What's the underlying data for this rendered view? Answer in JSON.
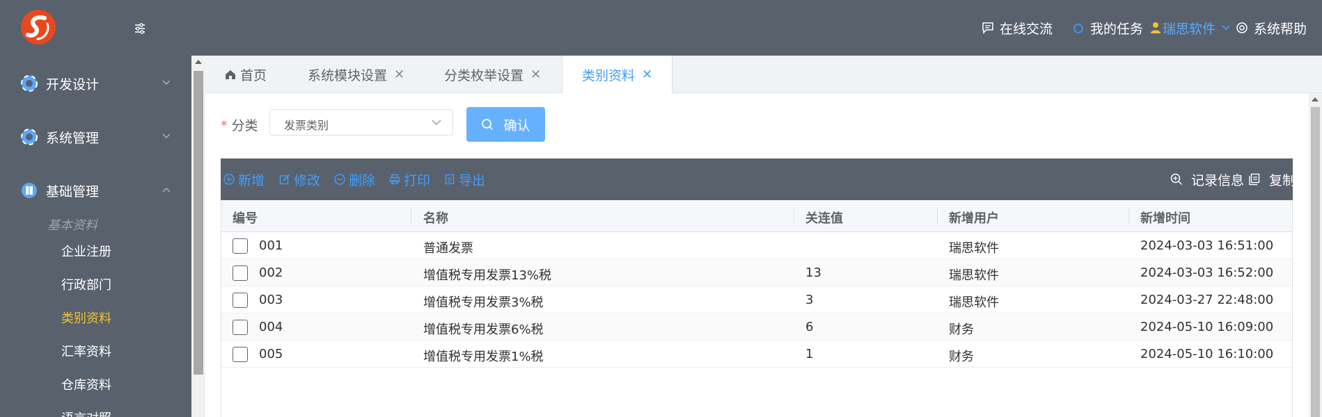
{
  "header": {
    "online_chat": "在线交流",
    "my_tasks": "我的任务",
    "user": "瑞思软件",
    "help": "系统帮助"
  },
  "sidebar": {
    "groups": [
      {
        "label": "开发设计"
      },
      {
        "label": "系统管理"
      },
      {
        "label": "基础管理"
      }
    ],
    "sub_caption": "基本资料",
    "items": [
      "企业注册",
      "行政部门",
      "类别资料",
      "汇率资料",
      "仓库资料",
      "语言对照"
    ]
  },
  "tabs": {
    "home": "首页",
    "items": [
      "系统模块设置",
      "分类枚举设置",
      "类别资料"
    ]
  },
  "form": {
    "label": "分类",
    "required_mark": "*",
    "select_value": "发票类别",
    "confirm": "确认"
  },
  "toolbar": {
    "add": "新增",
    "edit": "修改",
    "delete": "删除",
    "print": "打印",
    "export": "导出",
    "record_info": "记录信息",
    "copy": "复制"
  },
  "table": {
    "columns": [
      "编号",
      "名称",
      "关连值",
      "新增用户",
      "新增时间"
    ],
    "rows": [
      {
        "code": "001",
        "name": "普通发票",
        "value": "",
        "user": "瑞思软件",
        "time": "2024-03-03 16:51:00"
      },
      {
        "code": "002",
        "name": "增值税专用发票13%税",
        "value": "13",
        "user": "瑞思软件",
        "time": "2024-03-03 16:52:00"
      },
      {
        "code": "003",
        "name": "增值税专用发票3%税",
        "value": "3",
        "user": "瑞思软件",
        "time": "2024-03-27 22:48:00"
      },
      {
        "code": "004",
        "name": "增值税专用发票6%税",
        "value": "6",
        "user": "财务",
        "time": "2024-05-10 16:09:00"
      },
      {
        "code": "005",
        "name": "增值税专用发票1%税",
        "value": "1",
        "user": "财务",
        "time": "2024-05-10 16:10:00"
      }
    ]
  },
  "colors": {
    "accent": "#409eff",
    "active_menu": "#f2c230",
    "chrome": "#59616d",
    "logo": "#e8481e"
  }
}
